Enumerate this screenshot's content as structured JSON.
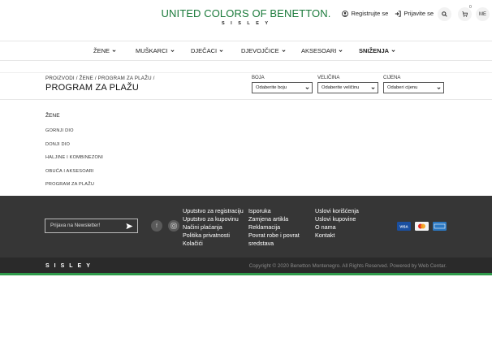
{
  "header": {
    "logo": "UNITED COLORS OF BENETTON.",
    "logo_sub": "SISLEY",
    "register": "Registrujte se",
    "login": "Prijavite se",
    "cart_count": "0",
    "lang": "ME"
  },
  "nav": {
    "items": [
      "ŽENE",
      "MUŠKARCI",
      "DJEČACI",
      "DJEVOJČICE",
      "AKSESOARI",
      "SNIŽENJA"
    ]
  },
  "breadcrumb": "PROIZVODI / ŽENE / PROGRAM ZA PLAŽU /",
  "title": "PROGRAM ZA PLAŽU",
  "filters": [
    {
      "label": "BOJA",
      "placeholder": "Odaberite boju"
    },
    {
      "label": "VELIČINA",
      "placeholder": "Odaberite veličinu"
    },
    {
      "label": "CIJENA",
      "placeholder": "Odaberi cijenu"
    }
  ],
  "categories": {
    "head": "ŽENE",
    "items": [
      "GORNJI DIO",
      "DONJI DIO",
      "HALJINE I KOMBINEZONI",
      "OBUĆA I AKSESOARI",
      "PROGRAM ZA PLAŽU"
    ]
  },
  "footer": {
    "newsletter_placeholder": "Prijava na Newsletter!",
    "col1": [
      "Uputstvo za registraciju",
      "Uputstvo za kupovinu",
      "Načini plaćanja",
      "Politika privatnosti",
      "Kolačići"
    ],
    "col2": [
      "Isporuka",
      "Zamjena artikla",
      "Reklamacija",
      "Povrat robe i povrat",
      "sredstava"
    ],
    "col3": [
      "Uslovi korišćenja",
      "Uslovi kupovine",
      "O nama",
      "Kontakt"
    ],
    "payment": [
      "VISA",
      "mastercard",
      "AMEX"
    ],
    "brand": "SISLEY",
    "copyright": "Copyright © 2020 Benetton Montenegro. All Rights Reserved. Powered by Web Centar."
  },
  "colors": {
    "brand_green": "#1a7a3a",
    "footer_bg": "#363636",
    "accent_line": "#2e9a4a"
  }
}
